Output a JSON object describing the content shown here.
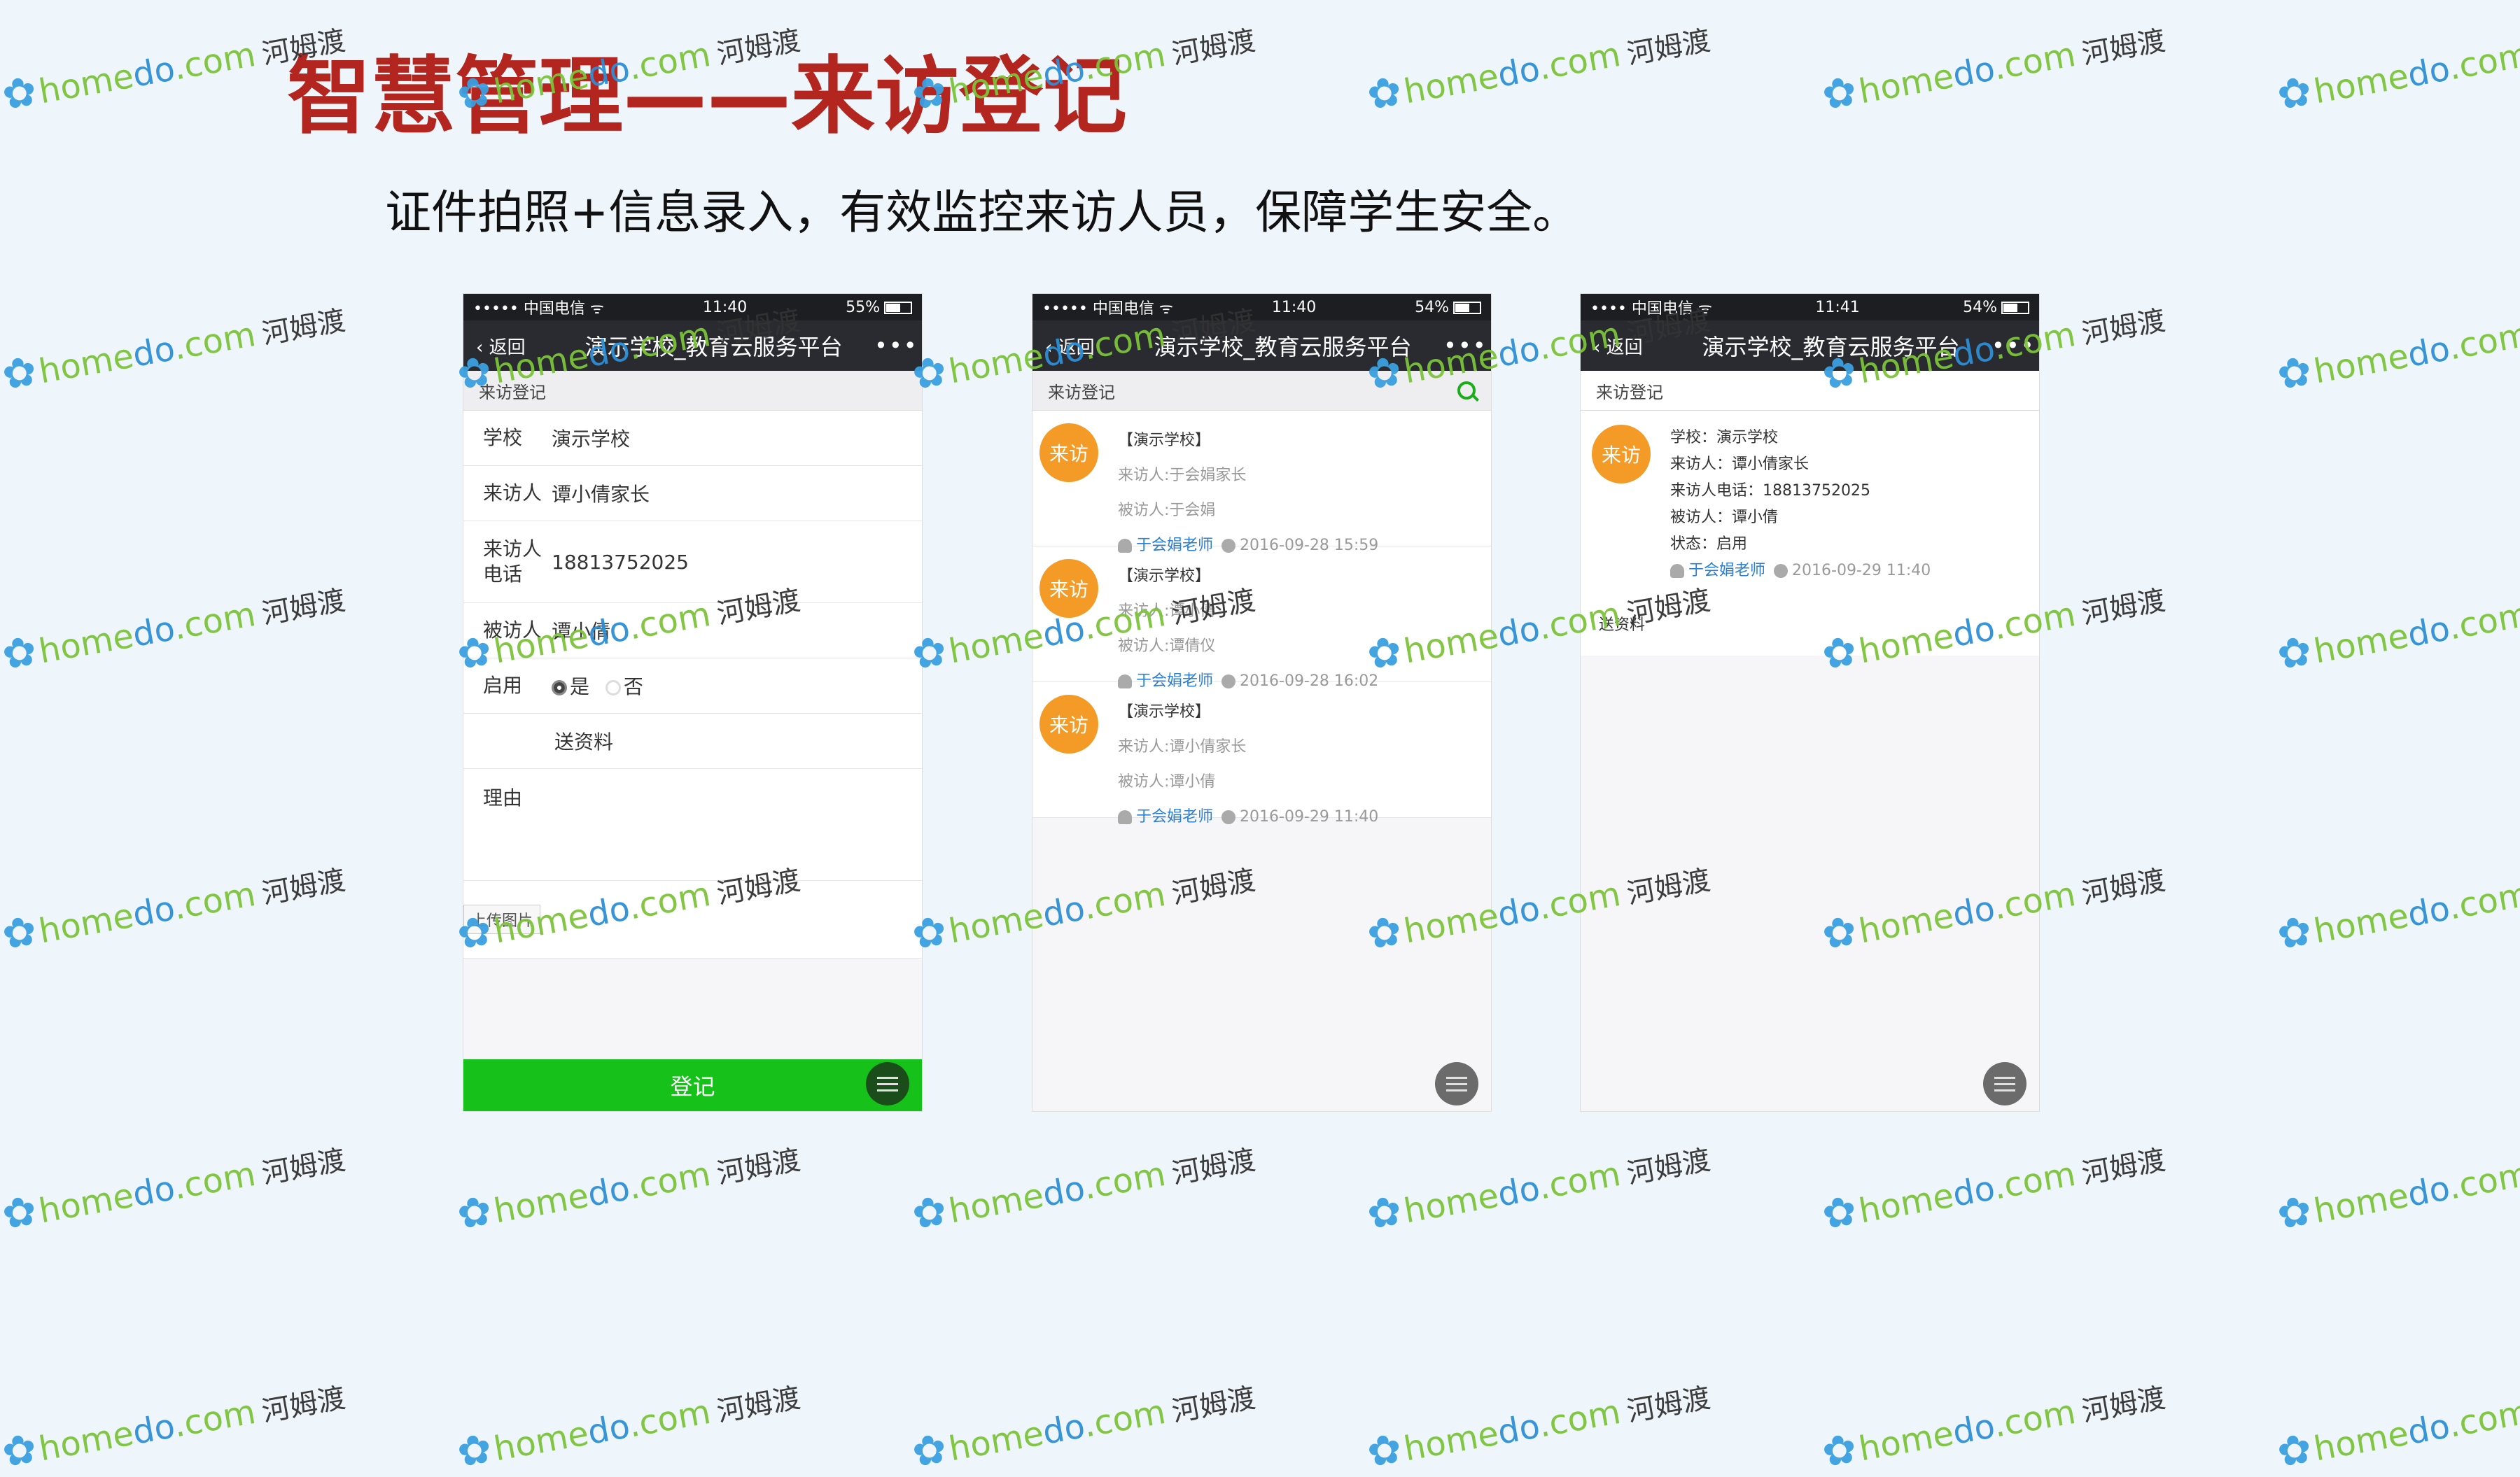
{
  "slide": {
    "title": "智慧管理——来访登记",
    "subtitle": "证件拍照+信息录入，有效监控来访人员，保障学生安全。"
  },
  "phone_common": {
    "back_label": "返回",
    "nav_title": "演示学校_教育云服务平台",
    "more_label": "•••"
  },
  "phone1": {
    "status": {
      "carrier": "••••• 中国电信 ᯤ",
      "time": "11:40",
      "battery": "55%"
    },
    "section": "来访登记",
    "fields": [
      {
        "label": "学校",
        "value": "演示学校"
      },
      {
        "label": "来访人",
        "value": "谭小倩家长"
      },
      {
        "label": "来访人电话",
        "value": "18813752025"
      },
      {
        "label": "被访人",
        "value": "谭小倩"
      }
    ],
    "enable_label": "启用",
    "opt_yes": "是",
    "opt_no": "否",
    "send_label": "送资料",
    "reason_label": "理由",
    "upload_label": "上传图片",
    "submit_label": "登记"
  },
  "phone2": {
    "status": {
      "carrier": "••••• 中国电信 ᯤ",
      "time": "11:40",
      "battery": "54%"
    },
    "section": "来访登记",
    "items": [
      {
        "badge": "来访",
        "school": "【演示学校】",
        "visitor": "来访人:于会娟家长",
        "host": "被访人:于会娟",
        "teacher": "于会娟老师",
        "time": "2016-09-28 15:59"
      },
      {
        "badge": "来访",
        "school": "【演示学校】",
        "visitor": "来访人:谭小倩",
        "host": "被访人:谭倩仪",
        "teacher": "于会娟老师",
        "time": "2016-09-28 16:02"
      },
      {
        "badge": "来访",
        "school": "【演示学校】",
        "visitor": "来访人:谭小倩家长",
        "host": "被访人:谭小倩",
        "teacher": "于会娟老师",
        "time": "2016-09-29 11:40"
      }
    ]
  },
  "phone3": {
    "status": {
      "carrier": "•••• 中国电信 ᯤ",
      "time": "11:41",
      "battery": "54%"
    },
    "section": "来访登记",
    "badge": "来访",
    "lines": [
      "学校：演示学校",
      "来访人：谭小倩家长",
      "来访人电话：18813752025",
      "被访人：谭小倩",
      "状态：启用"
    ],
    "teacher": "于会娟老师",
    "time": "2016-09-29 11:40",
    "footer": "送资料"
  },
  "watermark": {
    "prefix": "home",
    "mid": "do",
    "suffix": ".com",
    "cn": "河姆渡"
  },
  "colors": {
    "title": "#b3251f",
    "accent_green": "#16c11a",
    "badge_orange": "#f39a27",
    "link_blue": "#2a7fd4"
  }
}
